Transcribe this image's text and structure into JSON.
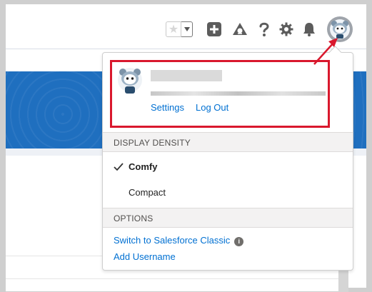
{
  "header": {
    "favorites_star": "★",
    "icons": [
      "favorites-dropdown-icon",
      "global-actions-icon",
      "trailhead-icon",
      "help-icon",
      "setup-gear-icon",
      "notifications-bell-icon",
      "user-avatar-icon"
    ]
  },
  "user_menu": {
    "settings_label": "Settings",
    "logout_label": "Log Out"
  },
  "display_density": {
    "header": "DISPLAY DENSITY",
    "options": [
      {
        "label": "Comfy",
        "selected": true
      },
      {
        "label": "Compact",
        "selected": false
      }
    ]
  },
  "options": {
    "header": "OPTIONS",
    "switch_classic": "Switch to Salesforce Classic",
    "add_username": "Add Username"
  },
  "colors": {
    "annotation_red": "#d9182d",
    "link_blue": "#0070d2",
    "band_blue": "#1f6fbf"
  }
}
